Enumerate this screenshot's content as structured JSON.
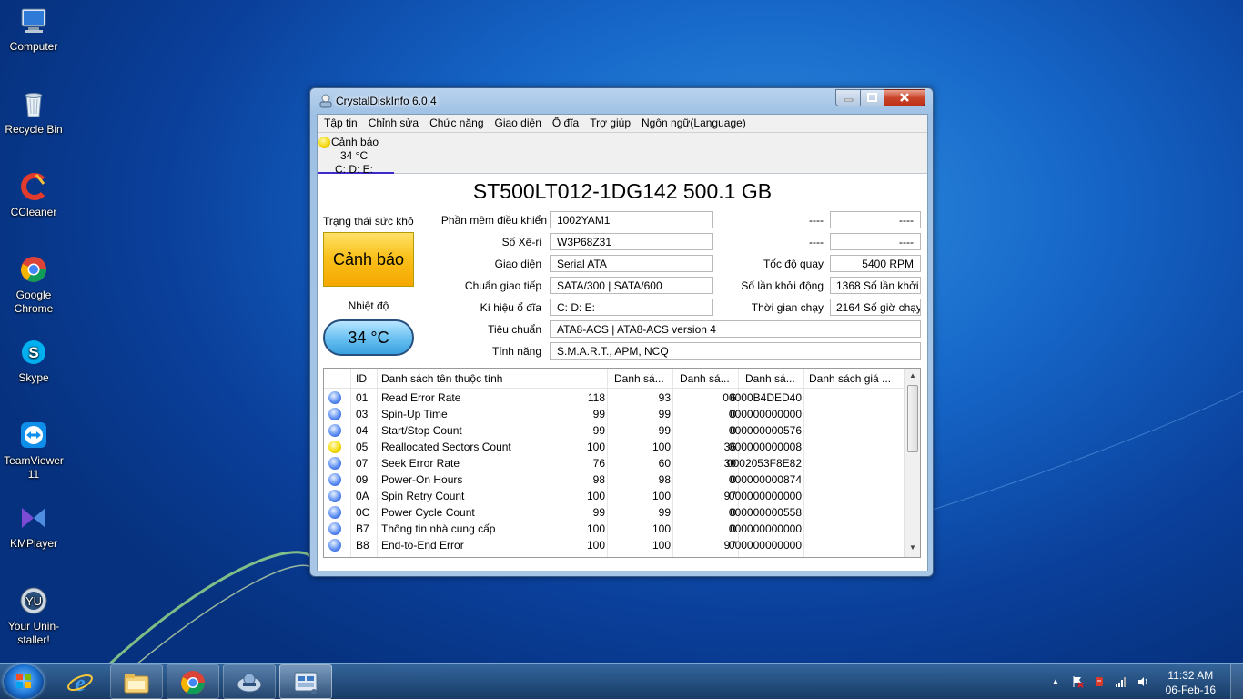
{
  "desktop": {
    "icons": [
      {
        "label": "Computer",
        "icon": "computer-icon"
      },
      {
        "label": "Recycle Bin",
        "icon": "recycle-bin-icon"
      },
      {
        "label": "CCleaner",
        "icon": "ccleaner-icon"
      },
      {
        "label": "Google Chrome",
        "icon": "chrome-icon"
      },
      {
        "label": "Skype",
        "icon": "skype-icon"
      },
      {
        "label": "TeamViewer 11",
        "icon": "teamviewer-icon"
      },
      {
        "label": "KMPlayer",
        "icon": "kmplayer-icon"
      },
      {
        "label": "Your Unin-staller!",
        "icon": "uninstaller-icon"
      }
    ]
  },
  "window": {
    "title": "CrystalDiskInfo 6.0.4",
    "menu": [
      "Tập tin",
      "Chỉnh sửa",
      "Chức năng",
      "Giao diện",
      "Ổ đĩa",
      "Trợ giúp",
      "Ngôn ngữ(Language)"
    ],
    "disk_tab": {
      "status": "Cảnh báo",
      "temp": "34 °C",
      "letters": "C: D: E:"
    }
  },
  "disk": {
    "title": "ST500LT012-1DG142 500.1 GB",
    "health_label": "Trạng thái sức khỏe",
    "health_value": "Cảnh báo",
    "temp_label": "Nhiệt độ",
    "temp_value": "34 °C",
    "firmware_label": "Phần mềm điều khiển",
    "firmware": "1002YAM1",
    "serial_label": "Số Xê-ri",
    "serial": "W3P68Z31",
    "interface_label": "Giao diện",
    "interface": "Serial ATA",
    "transfer_label": "Chuẩn giao tiếp",
    "transfer": "SATA/300 | SATA/600",
    "drive_letter_label": "Kí hiệu ổ đĩa",
    "drive_letter": "C: D: E:",
    "standard_label": "Tiêu chuẩn",
    "standard": "ATA8-ACS | ATA8-ACS version 4",
    "features_label": "Tính năng",
    "features": "S.M.A.R.T., APM, NCQ",
    "blank1_label": "----",
    "blank1": "----",
    "blank2_label": "----",
    "blank2": "----",
    "rotation_label": "Tốc độ quay",
    "rotation": "5400 RPM",
    "power_count_label": "Số lần khởi động",
    "power_count": "1368 Số lần khởi",
    "power_hours_label": "Thời gian chạy",
    "power_hours": "2164 Số giờ chạy"
  },
  "smart": {
    "headers": {
      "id": "ID",
      "name": "Danh sách tên thuộc tính",
      "current": "Danh sá...",
      "worst": "Danh sá...",
      "threshold": "Danh sá...",
      "raw": "Danh sách giá ..."
    },
    "rows": [
      {
        "id": "01",
        "name": "Read Error Rate",
        "current": "118",
        "worst": "93",
        "threshold": "6",
        "raw": "00000B4DED40",
        "status": "good"
      },
      {
        "id": "03",
        "name": "Spin-Up Time",
        "current": "99",
        "worst": "99",
        "threshold": "0",
        "raw": "000000000000",
        "status": "good"
      },
      {
        "id": "04",
        "name": "Start/Stop Count",
        "current": "99",
        "worst": "99",
        "threshold": "0",
        "raw": "000000000576",
        "status": "good"
      },
      {
        "id": "05",
        "name": "Reallocated Sectors Count",
        "current": "100",
        "worst": "100",
        "threshold": "36",
        "raw": "000000000008",
        "status": "warn"
      },
      {
        "id": "07",
        "name": "Seek Error Rate",
        "current": "76",
        "worst": "60",
        "threshold": "30",
        "raw": "0002053F8E82",
        "status": "good"
      },
      {
        "id": "09",
        "name": "Power-On Hours",
        "current": "98",
        "worst": "98",
        "threshold": "0",
        "raw": "000000000874",
        "status": "good"
      },
      {
        "id": "0A",
        "name": "Spin Retry Count",
        "current": "100",
        "worst": "100",
        "threshold": "97",
        "raw": "000000000000",
        "status": "good"
      },
      {
        "id": "0C",
        "name": "Power Cycle Count",
        "current": "99",
        "worst": "99",
        "threshold": "0",
        "raw": "000000000558",
        "status": "good"
      },
      {
        "id": "B7",
        "name": "Thông tin nhà cung cấp",
        "current": "100",
        "worst": "100",
        "threshold": "0",
        "raw": "000000000000",
        "status": "good"
      },
      {
        "id": "B8",
        "name": "End-to-End Error",
        "current": "100",
        "worst": "100",
        "threshold": "97",
        "raw": "000000000000",
        "status": "good"
      }
    ]
  },
  "taskbar": {
    "pinned": [
      "internet-explorer-icon",
      "file-explorer-icon",
      "chrome-icon",
      "app-icon",
      "crystaldiskinfo-icon"
    ],
    "time": "11:32 AM",
    "date": "06-Feb-16"
  },
  "colors": {
    "warning_yellow": "#f9c11b",
    "good_blue": "#5d8ef2",
    "desktop_blue": "#1565c7"
  }
}
